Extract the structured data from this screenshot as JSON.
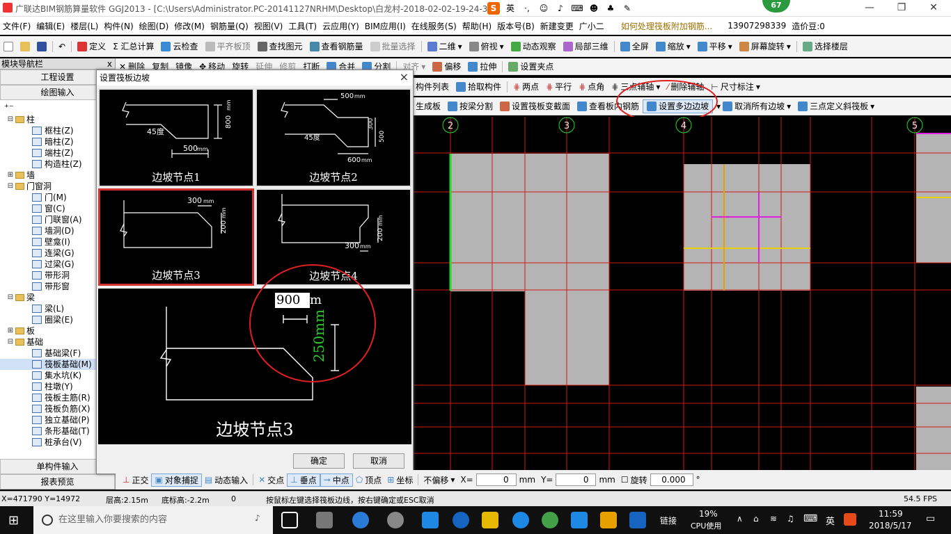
{
  "window": {
    "title": "广联达BIM钢筋算量软件 GGJ2013 - [C:\\Users\\Administrator.PC-20141127NRHM\\Desktop\\白龙村-2018-02-02-19-24-35",
    "badge": "67",
    "ime_label": "英"
  },
  "menu": [
    "文件(F)",
    "编辑(E)",
    "楼层(L)",
    "构件(N)",
    "绘图(D)",
    "修改(M)",
    "钢筋量(Q)",
    "视图(V)",
    "工具(T)",
    "云应用(Y)",
    "BIM应用(I)",
    "在线服务(S)",
    "帮助(H)",
    "版本号(B)",
    "新建变更",
    "广小二",
    "如何处理筏板附加钢筋...",
    "13907298339",
    "造价豆:0"
  ],
  "toolbar1": [
    "定义",
    "Σ 汇总计算",
    "云检查",
    "平齐板顶",
    "查找图元",
    "查看钢筋量",
    "批量选择",
    "二维",
    "俯视",
    "动态观察",
    "局部三维",
    "全屏",
    "缩放",
    "平移",
    "屏幕旋转",
    "选择楼层"
  ],
  "toolbar2": [
    "删除",
    "复制",
    "镜像",
    "移动",
    "旋转",
    "延伸",
    "修剪",
    "打断",
    "合并",
    "分割",
    "对齐",
    "偏移",
    "拉伸",
    "设置夹点"
  ],
  "toolbar3": [
    "构件列表",
    "拾取构件",
    "两点",
    "平行",
    "点角",
    "三点辅轴",
    "删除辅轴",
    "尺寸标注"
  ],
  "toolbar4": [
    "生成板",
    "按梁分割",
    "设置筏板变截面",
    "查看板内钢筋",
    "设置多边边坡",
    "取消所有边坡",
    "三点定义斜筏板"
  ],
  "nav": {
    "title": "模块导航栏",
    "pin": "ⅹ",
    "btn_settings": "工程设置",
    "btn_draw": "绘图输入",
    "btn_single": "单构件输入",
    "btn_report": "报表预览",
    "tree": [
      {
        "level": 0,
        "exp": "⊟",
        "folder": true,
        "label": "柱"
      },
      {
        "level": 1,
        "label": "框柱(Z)"
      },
      {
        "level": 1,
        "label": "暗柱(Z)"
      },
      {
        "level": 1,
        "label": "端柱(Z)"
      },
      {
        "level": 1,
        "label": "构造柱(Z)"
      },
      {
        "level": 0,
        "exp": "⊞",
        "folder": true,
        "label": "墙"
      },
      {
        "level": 0,
        "exp": "⊟",
        "folder": true,
        "label": "门窗洞"
      },
      {
        "level": 1,
        "label": "门(M)"
      },
      {
        "level": 1,
        "label": "窗(C)"
      },
      {
        "level": 1,
        "label": "门联窗(A)"
      },
      {
        "level": 1,
        "label": "墙洞(D)"
      },
      {
        "level": 1,
        "label": "壁龛(I)"
      },
      {
        "level": 1,
        "label": "连梁(G)"
      },
      {
        "level": 1,
        "label": "过梁(G)"
      },
      {
        "level": 1,
        "label": "带形洞"
      },
      {
        "level": 1,
        "label": "带形窗"
      },
      {
        "level": 0,
        "exp": "⊟",
        "folder": true,
        "label": "梁"
      },
      {
        "level": 1,
        "label": "梁(L)"
      },
      {
        "level": 1,
        "label": "圈梁(E)"
      },
      {
        "level": 0,
        "exp": "⊞",
        "folder": true,
        "label": "板"
      },
      {
        "level": 0,
        "exp": "⊟",
        "folder": true,
        "label": "基础"
      },
      {
        "level": 1,
        "label": "基础梁(F)"
      },
      {
        "level": 1,
        "label": "筏板基础(M)",
        "selected": true
      },
      {
        "level": 1,
        "label": "集水坑(K)"
      },
      {
        "level": 1,
        "label": "柱墩(Y)"
      },
      {
        "level": 1,
        "label": "筏板主筋(R)"
      },
      {
        "level": 1,
        "label": "筏板负筋(X)"
      },
      {
        "level": 1,
        "label": "独立基础(P)"
      },
      {
        "level": 1,
        "label": "条形基础(T)"
      },
      {
        "level": 1,
        "label": "桩承台(V)"
      }
    ]
  },
  "dialog": {
    "title": "设置筏板边坡",
    "close": "×",
    "node1": {
      "caption": "边坡节点1",
      "angle": "45度",
      "w": "500",
      "w_unit": "mm",
      "h": "800",
      "h_unit": "mm"
    },
    "node2": {
      "caption": "边坡节点2",
      "top": "500",
      "top_unit": "mm",
      "h1": "300",
      "h2": "500",
      "angle": "45度",
      "bottom": "600",
      "bottom_unit": "mm"
    },
    "node3": {
      "caption": "边坡节点3",
      "w": "300",
      "w_unit": "mm",
      "h": "200",
      "h_unit": "mm"
    },
    "node4": {
      "caption": "边坡节点4",
      "w": "300",
      "w_unit": "mm",
      "h": "200",
      "h_unit": "mm"
    },
    "preview": {
      "caption": "边坡节点3",
      "width_value": "900",
      "width_unit": "m",
      "height": "250",
      "height_unit": "mm"
    },
    "ok": "确定",
    "cancel": "取消"
  },
  "canvas": {
    "axes": [
      "2",
      "3",
      "4",
      "5"
    ]
  },
  "snapbar": {
    "items": [
      "正交",
      "对象捕捉",
      "动态输入",
      "交点",
      "垂点",
      "中点",
      "顶点",
      "坐标"
    ],
    "offset": "不偏移",
    "x_label": "X=",
    "x_value": "0",
    "x_unit": "mm",
    "y_label": "Y=",
    "y_value": "0",
    "y_unit": "mm",
    "rotate": "旋转",
    "rotate_value": "0.000",
    "deg": "°"
  },
  "status": {
    "coords": "X=471790 Y=14972",
    "floor_height": "层高:2.15m",
    "bottom_height": "底标高:-2.2m",
    "zero": "0",
    "hint": "按鼠标左键选择筏板边线，按右键确定或ESC取消",
    "fps": "54.5 FPS"
  },
  "taskbar": {
    "search_placeholder": "在这里输入你要搜索的内容",
    "link": "链接",
    "cpu": "19%",
    "cpu_label": "CPU使用",
    "lang": "英",
    "time": "11:59",
    "date": "2018/5/17"
  },
  "colors": {
    "slab": "#b4b4b4",
    "gridline": "#d01818",
    "annotation_circle": "#e02020"
  }
}
